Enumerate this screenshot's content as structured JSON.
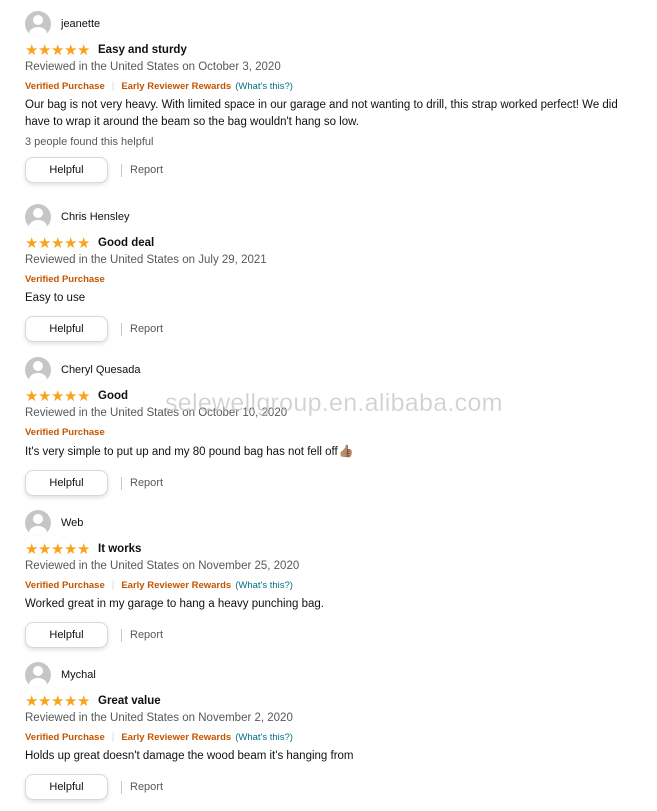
{
  "reviews": [
    {
      "name": "jeanette",
      "title": "Easy and sturdy",
      "rating": 5,
      "date": "Reviewed in the United States on October 3, 2020",
      "verified": "Verified Purchase",
      "early": "Early Reviewer Rewards",
      "whats": "(What's this?)",
      "body": "Our bag is not very heavy. With limited space in our garage and not wanting to drill, this strap worked perfect! We did have to wrap it around the beam so the bag wouldn't hang so low.",
      "helpful_count": "3 people found this helpful"
    },
    {
      "name": "Chris Hensley",
      "title": "Good deal",
      "rating": 5,
      "date": "Reviewed in the United States on July 29, 2021",
      "verified": "Verified Purchase",
      "body": "Easy to use"
    },
    {
      "name": "Cheryl Quesada",
      "title": "Good",
      "rating": 5,
      "date": "Reviewed in the United States on October 10, 2020",
      "verified": "Verified Purchase",
      "body": "It's very simple to put up and my 80 pound bag has not fell off",
      "emoji": "👍🏽"
    },
    {
      "name": "Web",
      "title": "It works",
      "rating": 5,
      "date": "Reviewed in the United States on November 25, 2020",
      "verified": "Verified Purchase",
      "early": "Early Reviewer Rewards",
      "whats": "(What's this?)",
      "body": "Worked great in my garage to hang a heavy punching bag."
    },
    {
      "name": "Mychal",
      "title": "Great value",
      "rating": 5,
      "date": "Reviewed in the United States on November 2, 2020",
      "verified": "Verified Purchase",
      "early": "Early Reviewer Rewards",
      "whats": "(What's this?)",
      "body": "Holds up great doesn't damage the wood beam it's hanging from"
    }
  ],
  "actions": {
    "helpful": "Helpful",
    "report": "Report"
  },
  "star_glyph": "★",
  "watermark": "selewellgroup.en.alibaba.com",
  "colors": {
    "star": "#f7a31c",
    "badge": "#c45500",
    "link": "#007185",
    "muted": "#565959"
  }
}
